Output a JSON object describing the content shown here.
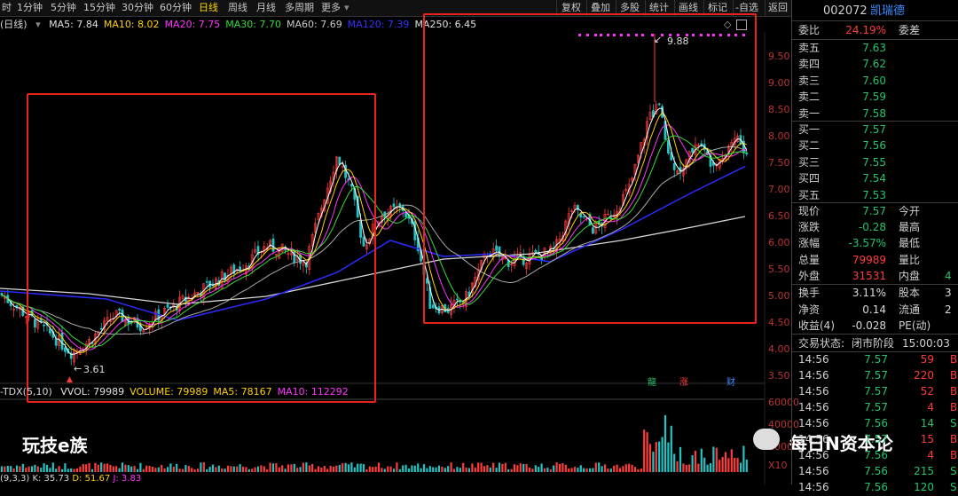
{
  "toolbar": {
    "timeframes": [
      "时",
      "1分钟",
      "5分钟",
      "15分钟",
      "30分钟",
      "60分钟",
      "日线",
      "周线",
      "月线",
      "多周期",
      "更多"
    ],
    "active": "日线",
    "tools": [
      "复权",
      "叠加",
      "多股",
      "统计",
      "画线",
      "标记",
      "-自选",
      "返回"
    ]
  },
  "ma_line": {
    "period": "(日线)",
    "items": [
      {
        "label": "MA5: 7.84",
        "color": "#e0e0e0"
      },
      {
        "label": "MA10: 8.02",
        "color": "#ffd200"
      },
      {
        "label": "MA20: 7.75",
        "color": "#ff33ff"
      },
      {
        "label": "MA30: 7.70",
        "color": "#33dd33"
      },
      {
        "label": "MA60: 7.69",
        "color": "#c8c8c8"
      },
      {
        "label": "MA120: 7.39",
        "color": "#3333ff"
      },
      {
        "label": "MA250: 6.45",
        "color": "#e0e0e0"
      }
    ]
  },
  "price_axis": [
    "9.50",
    "9.00",
    "8.50",
    "8.00",
    "7.50",
    "7.00",
    "6.50",
    "6.00",
    "5.50",
    "5.00",
    "4.50",
    "4.00",
    "3.50"
  ],
  "annotations": {
    "high": "9.88",
    "low": "3.61"
  },
  "volume_line": {
    "prefix": "-TDX(5,10)",
    "items": [
      {
        "label": "VVOL: 79989",
        "color": "#e0e0e0"
      },
      {
        "label": "VOLUME: 79989",
        "color": "#ffd200"
      },
      {
        "label": "MA5: 78167",
        "color": "#ffd200"
      },
      {
        "label": "MA10: 112292",
        "color": "#ff33ff"
      }
    ]
  },
  "volume_axis": [
    "60000",
    "40000",
    "20000",
    "X10"
  ],
  "tags": {
    "dragon": "龍",
    "zhang": "涨",
    "cai": "财"
  },
  "kdj": {
    "prefix": "(9,3,3)",
    "k": "K: 35.73",
    "d": "D: 51.67",
    "j": "J: 3.83"
  },
  "watermarks": {
    "left": "玩技e族",
    "right": "每日N资本论"
  },
  "stock": {
    "code": "002072",
    "name": "凯瑞德"
  },
  "weibi": {
    "label": "委比",
    "value": "24.19%",
    "label2": "委差"
  },
  "asks": [
    {
      "label": "卖五",
      "price": "7.63"
    },
    {
      "label": "卖四",
      "price": "7.62"
    },
    {
      "label": "卖三",
      "price": "7.60"
    },
    {
      "label": "卖二",
      "price": "7.59"
    },
    {
      "label": "卖一",
      "price": "7.58"
    }
  ],
  "bids": [
    {
      "label": "买一",
      "price": "7.57"
    },
    {
      "label": "买二",
      "price": "7.56"
    },
    {
      "label": "买三",
      "price": "7.55"
    },
    {
      "label": "买四",
      "price": "7.54"
    },
    {
      "label": "买五",
      "price": "7.53"
    }
  ],
  "quote": [
    {
      "l1": "现价",
      "v1": "7.57",
      "c1": "g",
      "l2": "今开",
      "v2": ""
    },
    {
      "l1": "涨跌",
      "v1": "-0.28",
      "c1": "g",
      "l2": "最高",
      "v2": ""
    },
    {
      "l1": "涨幅",
      "v1": "-3.57%",
      "c1": "g",
      "l2": "最低",
      "v2": ""
    },
    {
      "l1": "总量",
      "v1": "79989",
      "c1": "r",
      "l2": "量比",
      "v2": ""
    },
    {
      "l1": "外盘",
      "v1": "31531",
      "c1": "r",
      "l2": "内盘",
      "v2": "4"
    }
  ],
  "stats": [
    {
      "l1": "换手",
      "v1": "3.11%",
      "l2": "股本",
      "v2": "3"
    },
    {
      "l1": "净资",
      "v1": "0.14",
      "l2": "流通",
      "v2": "2"
    },
    {
      "l1": "收益(4)",
      "v1": "-0.028",
      "l2": "PE(动)",
      "v2": ""
    }
  ],
  "trade_status": {
    "label": "交易状态:",
    "status": "闭市阶段",
    "time": "15:00:03"
  },
  "ticks": [
    {
      "t": "14:56",
      "p": "7.57",
      "v": "59",
      "s": "B",
      "sc": "r"
    },
    {
      "t": "14:56",
      "p": "7.57",
      "v": "220",
      "s": "B",
      "sc": "r"
    },
    {
      "t": "14:56",
      "p": "7.57",
      "v": "52",
      "s": "B",
      "sc": "r"
    },
    {
      "t": "14:56",
      "p": "7.57",
      "v": "4",
      "s": "B",
      "sc": "r"
    },
    {
      "t": "14:56",
      "p": "7.56",
      "v": "14",
      "s": "S",
      "sc": "g"
    },
    {
      "t": "14:56",
      "p": "7.57",
      "v": "15",
      "s": "B",
      "sc": "r"
    },
    {
      "t": "14:56",
      "p": "7.56",
      "v": "4",
      "s": "B",
      "sc": "r"
    },
    {
      "t": "14:56",
      "p": "7.56",
      "v": "215",
      "s": "S",
      "sc": "g"
    },
    {
      "t": "14:56",
      "p": "7.56",
      "v": "120",
      "s": "S",
      "sc": "g"
    }
  ]
}
